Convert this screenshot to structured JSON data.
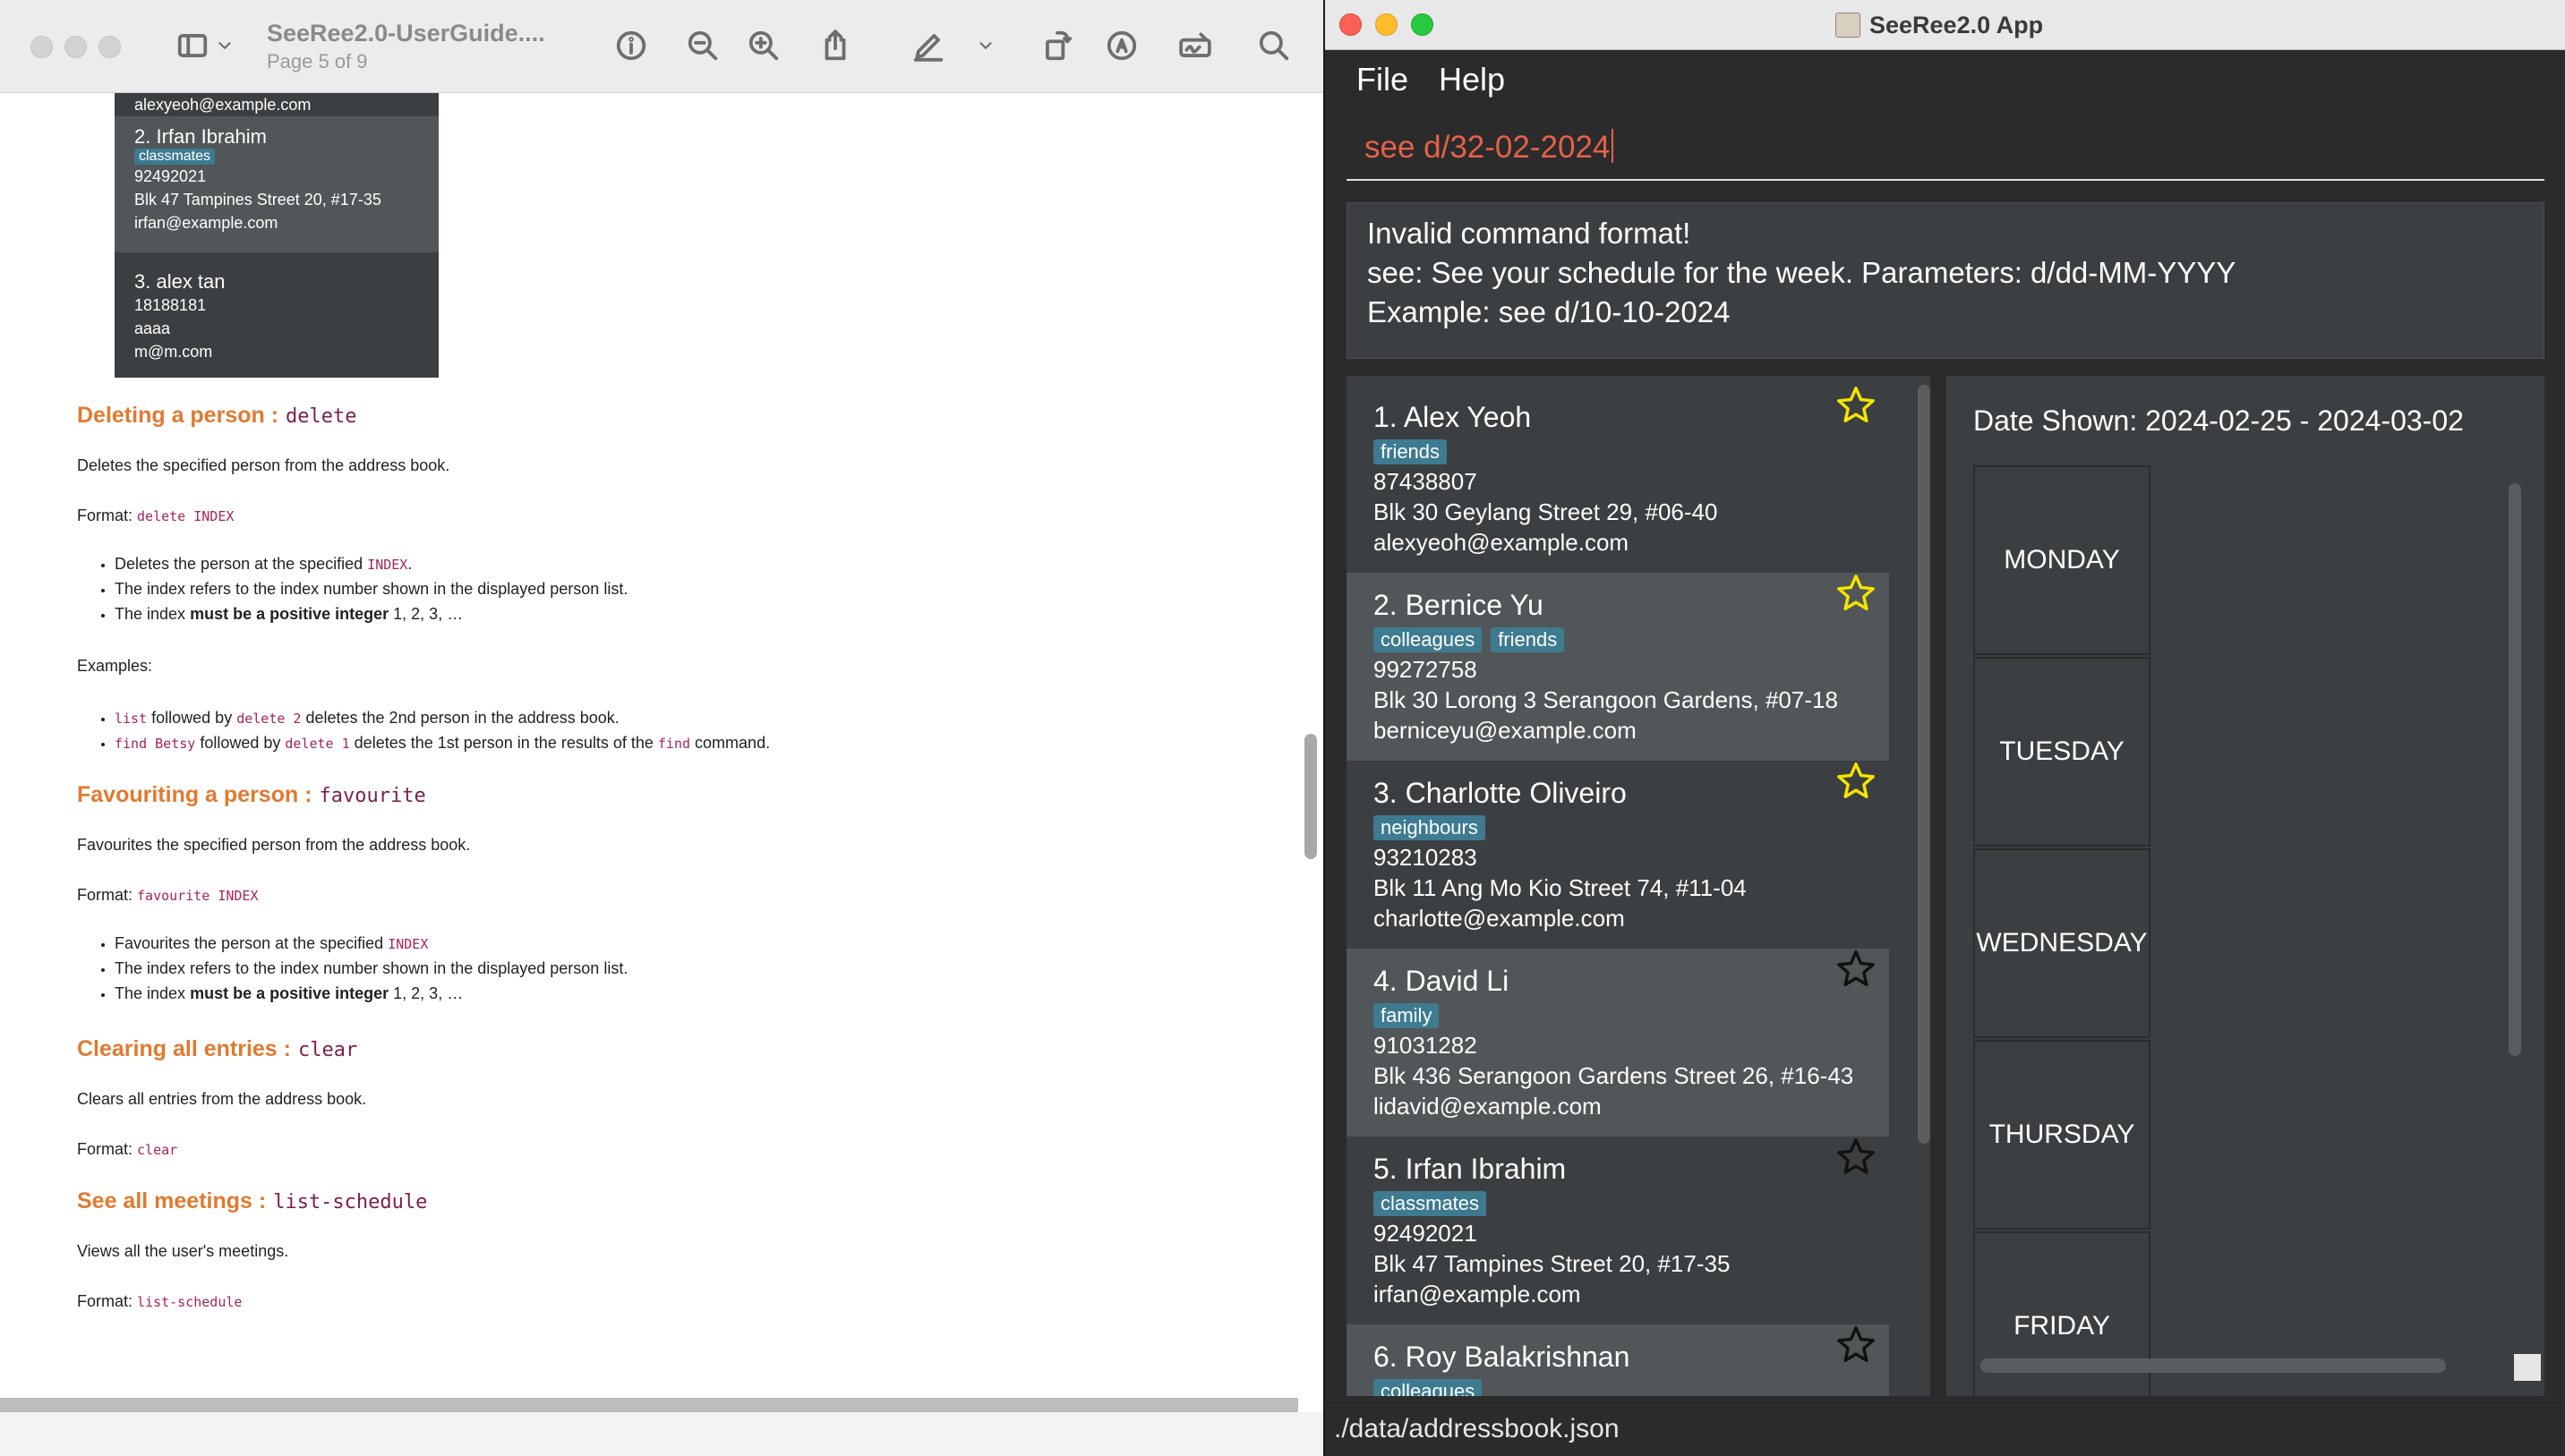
{
  "preview": {
    "title": "SeeRee2.0-UserGuide....",
    "subtitle": "Page 5 of 9",
    "embedded_list": {
      "email_top": "alexyeoh@example.com",
      "item2": {
        "name": "2. Irfan Ibrahim",
        "tag": "classmates",
        "phone": "92492021",
        "address": "Blk 47 Tampines Street 20, #17-35",
        "email": "irfan@example.com"
      },
      "item3": {
        "name": "3. alex tan",
        "phone": "18188181",
        "address": "aaaa",
        "email": "m@m.com"
      }
    },
    "delete": {
      "heading": "Deleting a person :",
      "cmd": "delete",
      "desc": "Deletes the specified person from the address book.",
      "format_label": "Format:",
      "format_code": "delete INDEX",
      "bullet1_pre": "Deletes the person at the specified",
      "bullet1_code": "INDEX",
      "bullet1_post": ".",
      "bullet2": "The index refers to the index number shown in the displayed person list.",
      "bullet3_pre": "The index",
      "bullet3_bold": "must be a positive integer",
      "bullet3_post": "1, 2, 3, …",
      "examples_label": "Examples:",
      "ex1_code1": "list",
      "ex1_mid": "followed by",
      "ex1_code2": "delete 2",
      "ex1_post": "deletes the 2nd person in the address book.",
      "ex2_code1": "find Betsy",
      "ex2_mid": "followed by",
      "ex2_code2": "delete 1",
      "ex2_post": "deletes the 1st person in the results of the",
      "ex2_code3": "find",
      "ex2_end": "command."
    },
    "favourite": {
      "heading": "Favouriting a person :",
      "cmd": "favourite",
      "desc": "Favourites the specified person from the address book.",
      "format_label": "Format:",
      "format_code": "favourite INDEX",
      "bullet1_pre": "Favourites the person at the specified",
      "bullet1_code": "INDEX",
      "bullet2": "The index refers to the index number shown in the displayed person list.",
      "bullet3_pre": "The index",
      "bullet3_bold": "must be a positive integer",
      "bullet3_post": "1, 2, 3, …"
    },
    "clear": {
      "heading": "Clearing all entries :",
      "cmd": "clear",
      "desc": "Clears all entries from the address book.",
      "format_label": "Format:",
      "format_code": "clear"
    },
    "schedule": {
      "heading": "See all meetings :",
      "cmd": "list-schedule",
      "desc": "Views all the user's meetings.",
      "format_label": "Format:",
      "format_code": "list-schedule"
    }
  },
  "app": {
    "window_title": "SeeRee2.0 App",
    "menu": {
      "file": "File",
      "help": "Help"
    },
    "command_input": "see d/32-02-2024",
    "result": {
      "line1": "Invalid command format!",
      "line2": "see: See your schedule for the week. Parameters: d/dd-MM-YYYY",
      "line3": "Example: see d/10-10-2024"
    },
    "persons": [
      {
        "name": "1. Alex Yeoh",
        "tags": [
          "friends"
        ],
        "phone": "87438807",
        "address": "Blk 30 Geylang Street 29, #06-40",
        "email": "alexyeoh@example.com",
        "favourite": true
      },
      {
        "name": "2. Bernice Yu",
        "tags": [
          "colleagues",
          "friends"
        ],
        "phone": "99272758",
        "address": "Blk 30 Lorong 3 Serangoon Gardens, #07-18",
        "email": "berniceyu@example.com",
        "favourite": true
      },
      {
        "name": "3. Charlotte Oliveiro",
        "tags": [
          "neighbours"
        ],
        "phone": "93210283",
        "address": "Blk 11 Ang Mo Kio Street 74, #11-04",
        "email": "charlotte@example.com",
        "favourite": true
      },
      {
        "name": "4. David Li",
        "tags": [
          "family"
        ],
        "phone": "91031282",
        "address": "Blk 436 Serangoon Gardens Street 26, #16-43",
        "email": "lidavid@example.com",
        "favourite": false
      },
      {
        "name": "5. Irfan Ibrahim",
        "tags": [
          "classmates"
        ],
        "phone": "92492021",
        "address": "Blk 47 Tampines Street 20, #17-35",
        "email": "irfan@example.com",
        "favourite": false
      },
      {
        "name": "6. Roy Balakrishnan",
        "tags": [
          "colleagues"
        ],
        "phone": "",
        "address": "",
        "email": "",
        "favourite": false
      }
    ],
    "schedule": {
      "date_shown": "Date Shown: 2024-02-25 - 2024-03-02",
      "days": [
        "MONDAY",
        "TUESDAY",
        "WEDNESDAY",
        "THURSDAY",
        "FRIDAY"
      ]
    },
    "status": "./data/addressbook.json"
  },
  "colors": {
    "accent_heading": "#e07a30",
    "tag_bg": "#3e7b91",
    "error_input": "#e3624a",
    "star_filled": "#f5e400",
    "app_bg": "#2b2b2b"
  }
}
